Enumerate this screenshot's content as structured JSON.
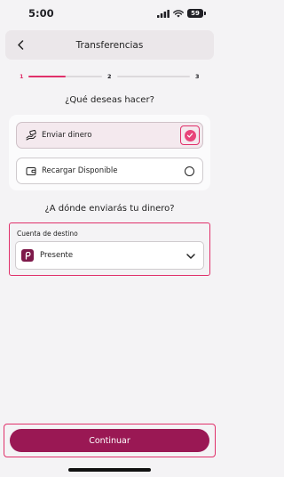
{
  "status_bar": {
    "time": "5:00",
    "battery_level": "59"
  },
  "header": {
    "title": "Transferencias",
    "back_icon": "chevron-left-icon"
  },
  "stepper": {
    "steps": [
      "1",
      "2",
      "3"
    ],
    "current_step": 1,
    "active_color": "#e0306a",
    "first_segment_progress": 0.5
  },
  "question_action": {
    "title": "¿Qué deseas hacer?",
    "options": [
      {
        "label": "Enviar dinero",
        "icon": "hand-money-icon",
        "selected": true
      },
      {
        "label": "Recargar Disponible",
        "icon": "wallet-icon",
        "selected": false
      }
    ]
  },
  "question_destination": {
    "title": "¿A dónde enviarás tu dinero?",
    "field_label": "Cuenta de destino",
    "selected_value": "Presente",
    "logo_icon": "account-logo-icon"
  },
  "footer": {
    "continue_label": "Continuar",
    "button_color": "#9a1854"
  }
}
